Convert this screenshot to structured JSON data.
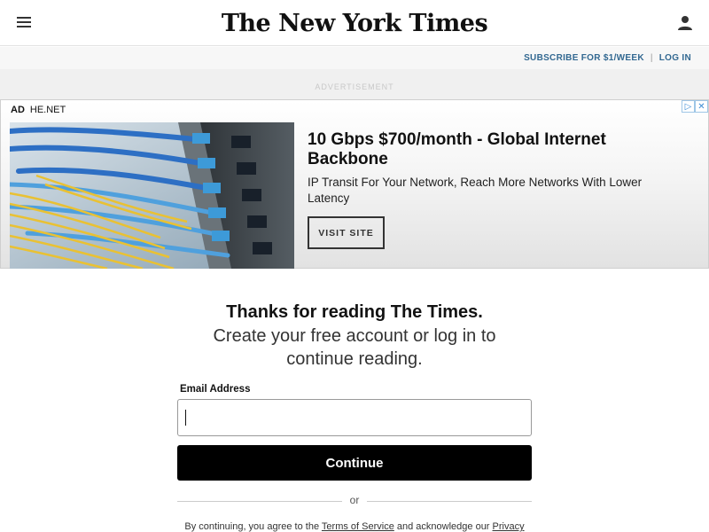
{
  "header": {
    "logo": "The New York Times",
    "menu_icon": "hamburger-menu-icon",
    "account_icon": "user-icon"
  },
  "subscribe_bar": {
    "subscribe_label": "SUBSCRIBE FOR $1/WEEK",
    "login_label": "LOG IN"
  },
  "advertisement": {
    "label": "ADVERTISEMENT",
    "tag": "AD",
    "advertiser": "HE.NET",
    "title": "10 Gbps $700/month - Global Internet Backbone",
    "description": "IP Transit For Your Network, Reach More Networks With Lower Latency",
    "cta": "VISIT SITE",
    "adchoices_icon": "adchoices-icon",
    "close_icon": "close-icon"
  },
  "regiwall": {
    "heading": "Thanks for reading The Times.",
    "subheading": "Create your free account or log in to continue reading.",
    "email_label": "Email Address",
    "email_value": "",
    "continue_label": "Continue",
    "divider_text": "or",
    "legal_prefix": "By continuing, you agree to the ",
    "terms_link": "Terms of Service",
    "legal_middle": " and acknowledge our ",
    "privacy_link": "Privacy"
  },
  "colors": {
    "link_blue": "#326891",
    "button_black": "#000000",
    "adchoices_blue": "#3b8bd4"
  }
}
